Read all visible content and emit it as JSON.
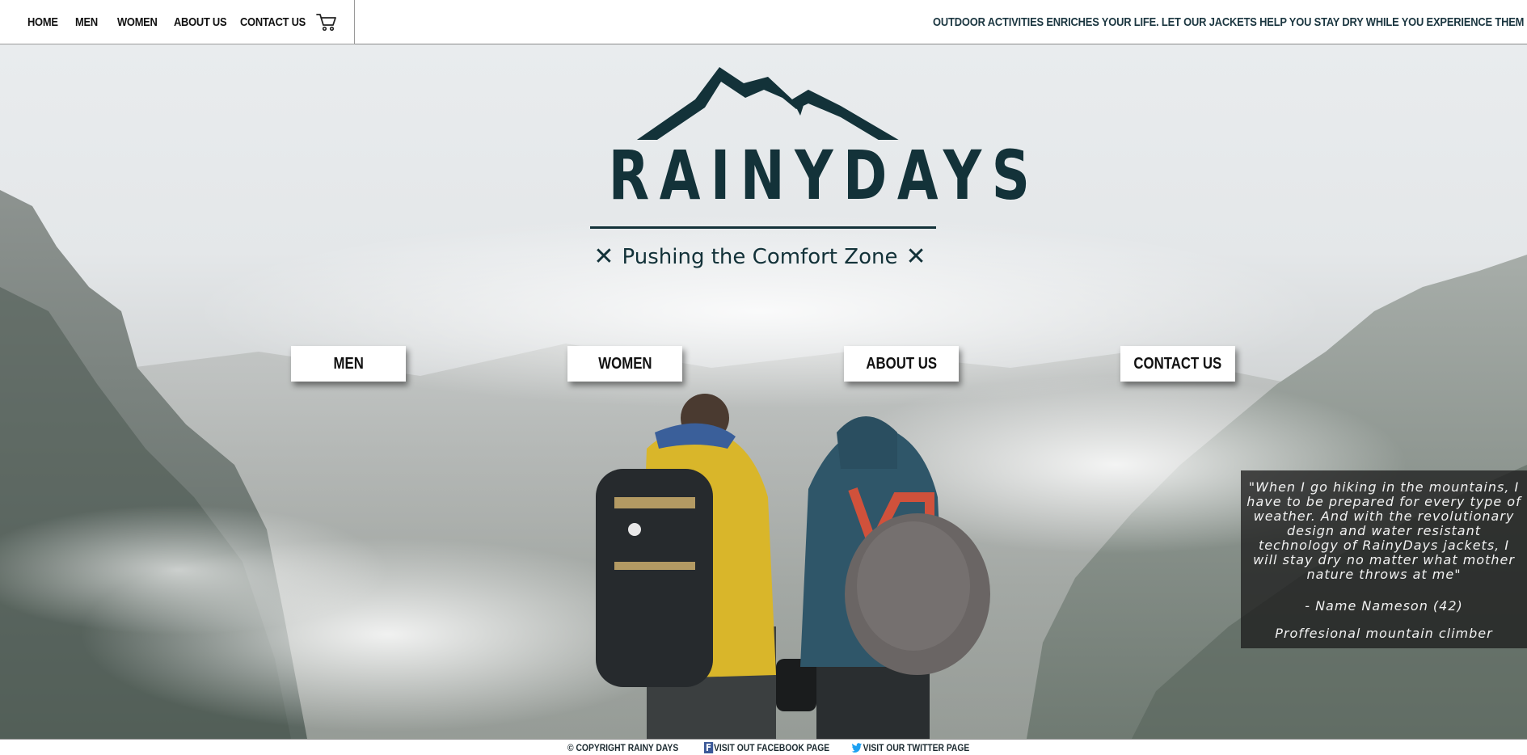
{
  "header": {
    "nav": [
      {
        "label": "HOME"
      },
      {
        "label": "MEN"
      },
      {
        "label": "WOMEN"
      },
      {
        "label": "ABOUT US"
      },
      {
        "label": "CONTACT US"
      }
    ],
    "cart_icon": "shopping-cart-icon",
    "slogan": "OUTDOOR ACTIVITIES ENRICHES YOUR LIFE. LET OUR JACKETS HELP YOU STAY DRY WHILE YOU EXPERIENCE THEM"
  },
  "hero": {
    "logo": {
      "wordmark": "RAINYDAYS",
      "tagline": "Pushing the Comfort Zone",
      "tagline_mark": "✕",
      "icon": "mountain-logo-icon"
    },
    "buttons": [
      {
        "label": "MEN"
      },
      {
        "label": "WOMEN"
      },
      {
        "label": "ABOUT US"
      },
      {
        "label": "CONTACT US"
      }
    ],
    "testimonial": {
      "quote": "\"When I go hiking in the mountains, I have to be prepared for every type of weather. And with the revolutionary design and water resistant technology of RainyDays jackets, I will stay dry no matter what mother nature throws at me\"",
      "author": "- Name Nameson (42)",
      "role": "Proffesional mountain climber"
    }
  },
  "footer": {
    "copyright": "© COPYRIGHT RAINY DAYS",
    "facebook": "VISIT OUT FACEBOOK PAGE",
    "twitter": "VISIT OUR TWITTER PAGE",
    "facebook_icon": "facebook-icon",
    "twitter_icon": "twitter-icon"
  },
  "colors": {
    "brand": "#133239",
    "testimonial_bg": "#1e1e1e"
  }
}
